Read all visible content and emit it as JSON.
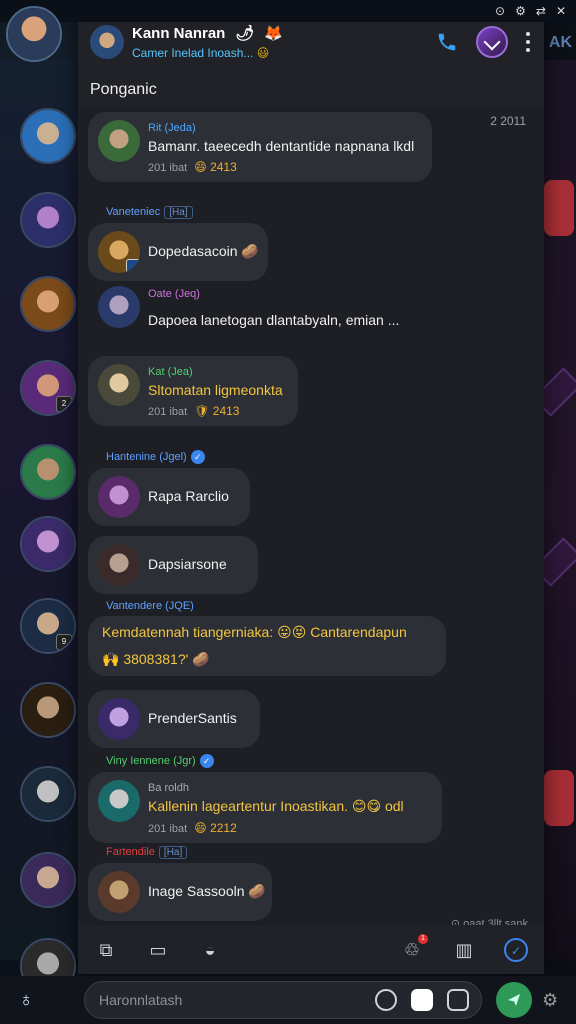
{
  "status_bar": {
    "items": [
      "⊙",
      "⚙",
      "⇄",
      "✕"
    ]
  },
  "side_text": "AK",
  "header": {
    "name": "Kann Nanran",
    "name_emoji": "🌶",
    "subtitle": "Camer Inelad Inoash...",
    "subtitle_emoji": "😃",
    "extra_emoji": "🦊",
    "phone_icon": "phone-icon",
    "badge_icon": "badge-icon",
    "menu_icon": "kebab-menu-icon"
  },
  "channel_title": "Ponganic",
  "pinned_time": "2 2011",
  "messages": [
    {
      "sender": "Rit (Jeda)",
      "sender_color": "#4aa8ff",
      "tag": "",
      "text": "Bamanr. taeecedh dentantide napnana lkdl",
      "gold_tail": true,
      "meta": "201 ibat",
      "reaction": "😄 2413"
    },
    {
      "sender": "Vaneteniec",
      "sender_color": "#5fa0ff",
      "tag": "[Ha]",
      "text": "Dopedasacoin 🥔",
      "meta": "",
      "reaction": ""
    },
    {
      "sender": "Oate (Jeq)",
      "sender_color": "#d070e0",
      "tag": "",
      "text": "Dapoea lanetogan dlantabyaln, emian ...",
      "meta": "",
      "reaction": ""
    },
    {
      "sender": "Kat (Jea)",
      "sender_color": "#50d070",
      "tag": "",
      "text": "Sltomatan ligmeonkta",
      "gold": true,
      "meta": "201 ibat",
      "reaction": "🛡 2413"
    },
    {
      "sender": "Hantenine (Jgel)",
      "sender_color": "#5fa0ff",
      "tag": "",
      "verified": true,
      "text": "Rapa Rarclio",
      "meta": "",
      "reaction": ""
    },
    {
      "sender": "",
      "text": "Dapsiarsone",
      "meta": "",
      "reaction": ""
    },
    {
      "sender": "Vantendere (JQE)",
      "sender_color": "#5fa0ff",
      "tag": "",
      "text": "Kemdatennah tiangerniaka: 😛😝 Cantarendapun",
      "gold": true,
      "extra": "🙌 3808381?' 🥔",
      "meta": "",
      "reaction": ""
    },
    {
      "sender": "",
      "text": "PrenderSantis",
      "meta": "",
      "reaction": ""
    },
    {
      "sender": "Viny Iennene (Jgr)",
      "sender_color": "#50d070",
      "tag": "",
      "verified": true,
      "subsender": "Ba roldh",
      "text": "Kallenin lageartentur Inoastikan. 😊😋 odl",
      "gold": true,
      "meta": "201 ibat",
      "reaction": "😄 2212"
    },
    {
      "sender": "Fartendile",
      "sender_color": "#e04040",
      "tag": "[Ha]",
      "text": "Inage Sassooln 🥔",
      "meta": "",
      "reaction": ""
    }
  ],
  "footer_note": "⊙ oaat 3llt sank",
  "bottom_nav": [
    "nav-puzzle-icon",
    "nav-clipboard-icon",
    "nav-gamepad-icon",
    "nav-notification-icon",
    "nav-layout-icon",
    "nav-twitter-icon"
  ],
  "notification_badge": "1",
  "input": {
    "placeholder": "Haronnlatash"
  }
}
